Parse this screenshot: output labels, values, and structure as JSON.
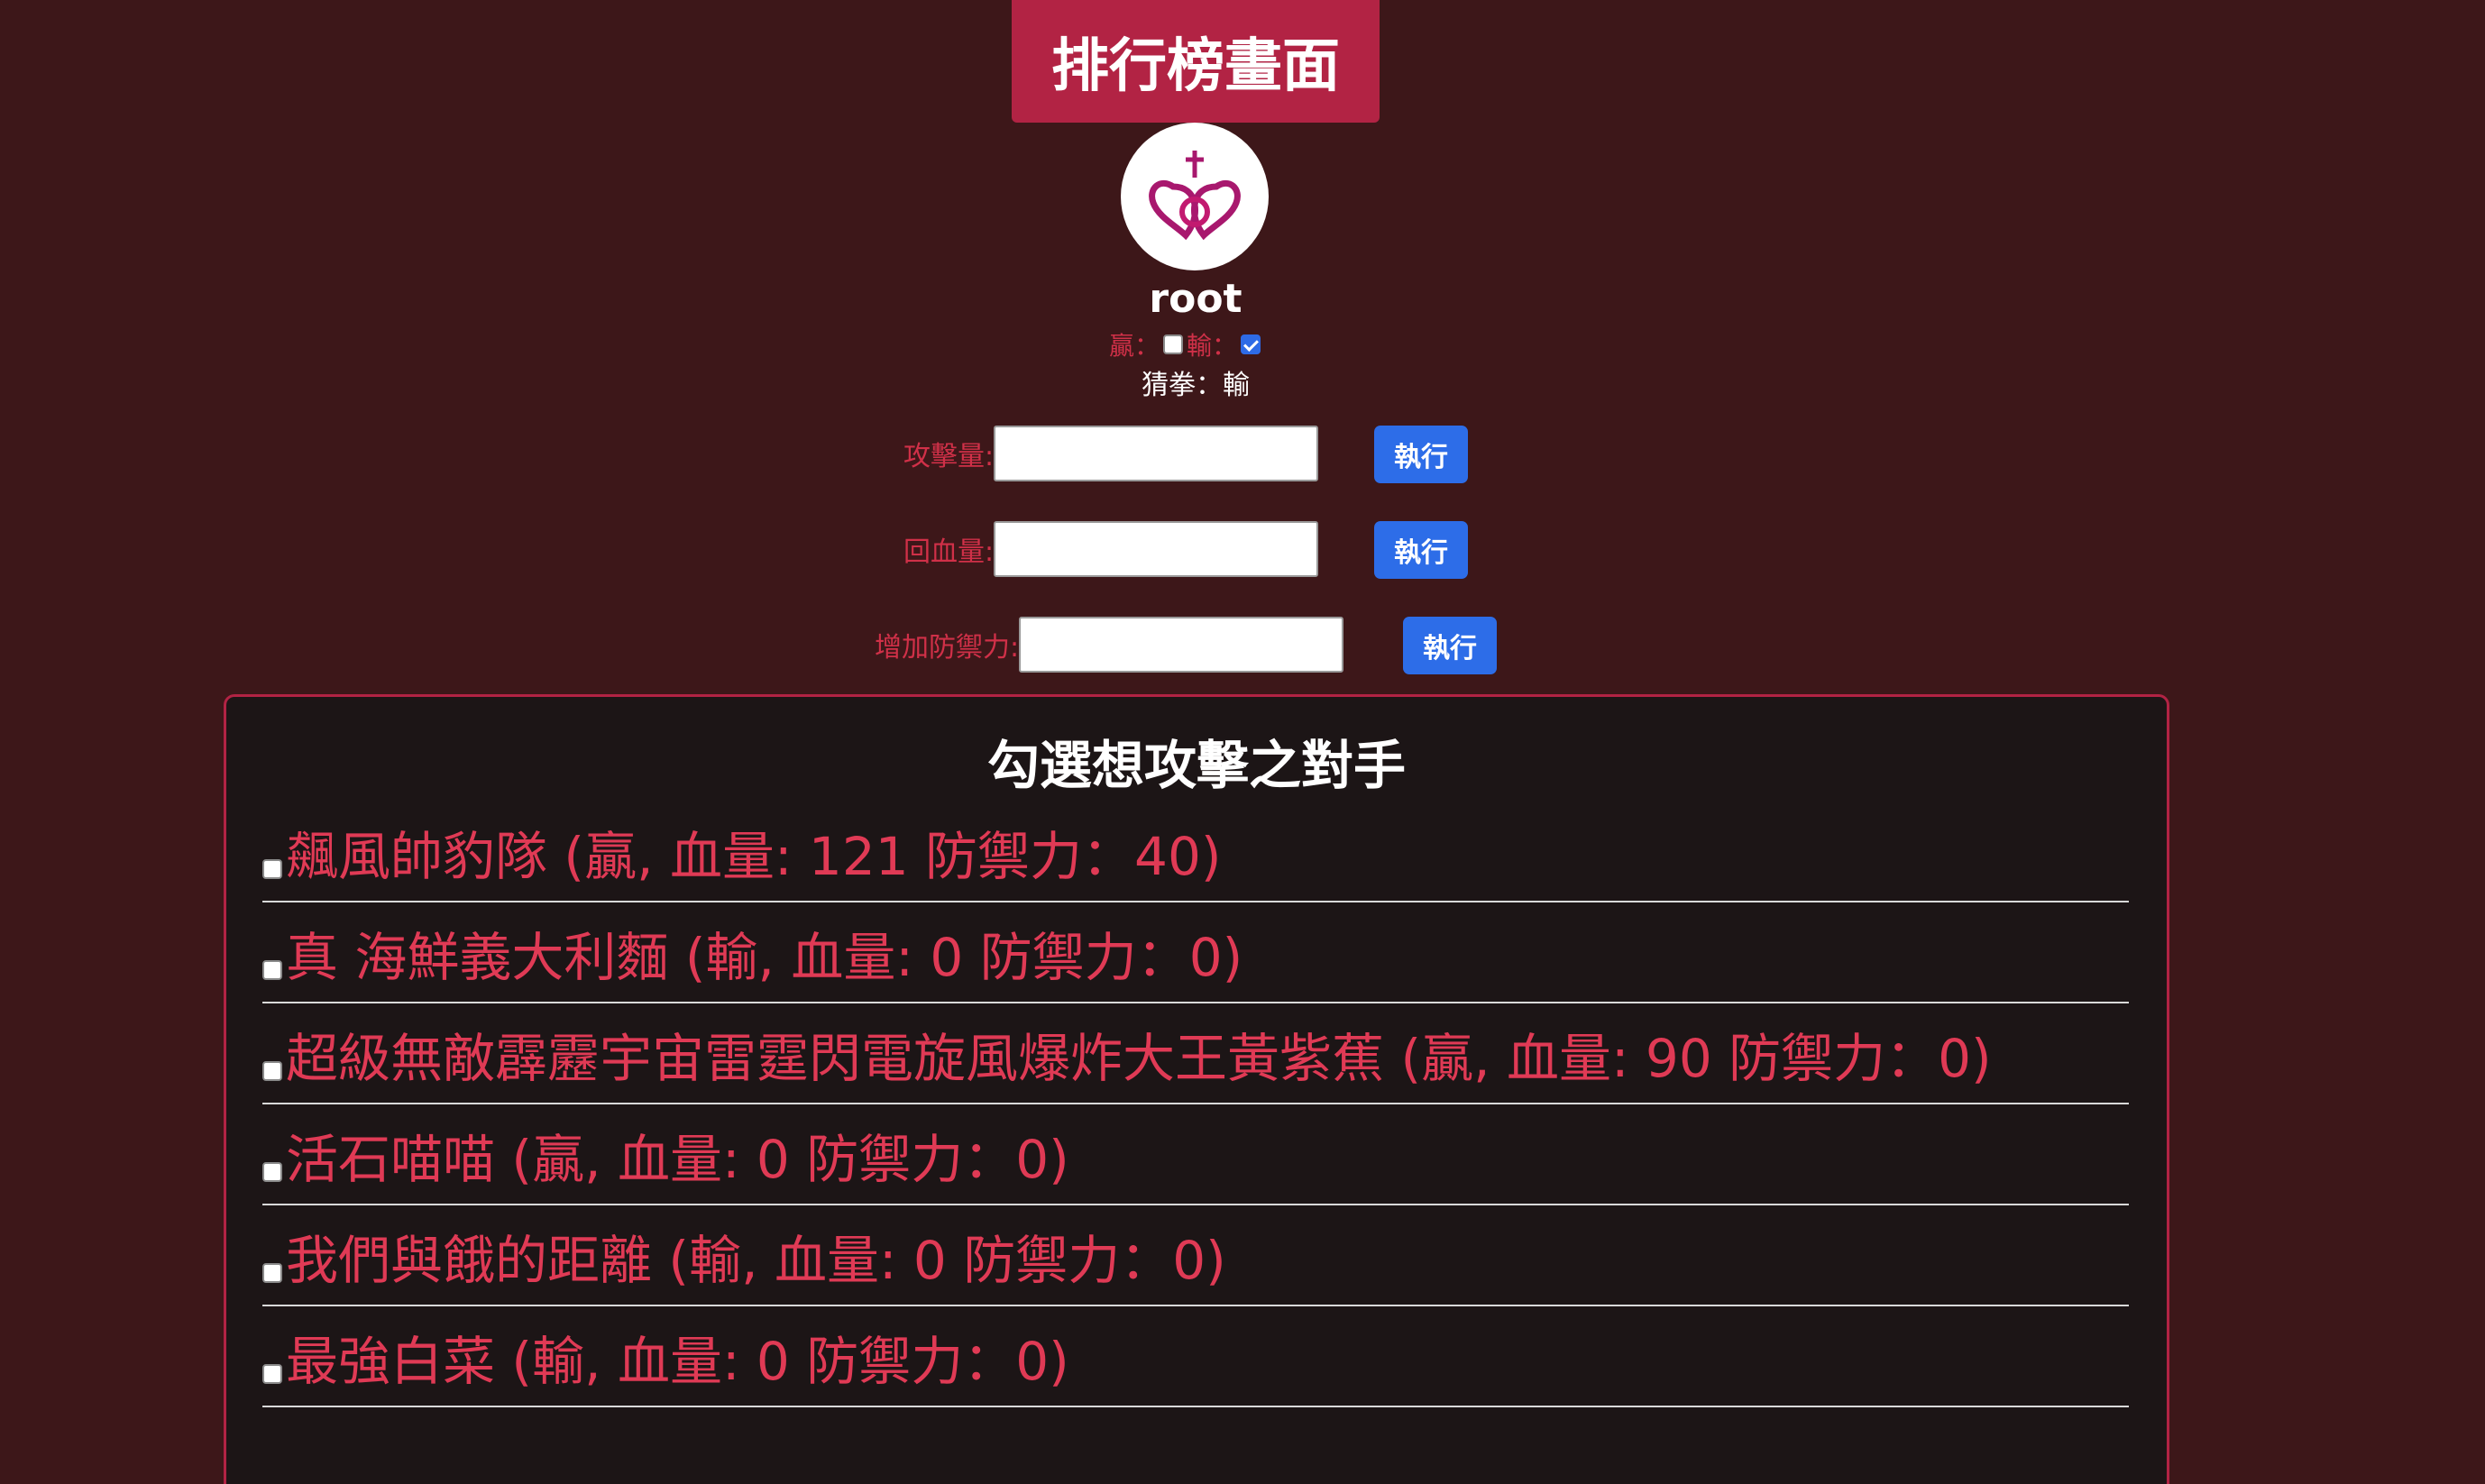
{
  "header": {
    "title_button": "排行榜畫面"
  },
  "profile": {
    "avatar_icon": "crowned-hearts-icon",
    "username": "root",
    "win_label": "贏：",
    "lose_label": "輸：",
    "win_checked": false,
    "lose_checked": true,
    "rps_result": "猜拳：輸"
  },
  "actions": {
    "attack_label": "攻擊量:",
    "heal_label": "回血量:",
    "defense_label": "增加防禦力:",
    "execute_label": "執行",
    "attack_value": "",
    "heal_value": "",
    "defense_value": ""
  },
  "opponents": {
    "title": "勾選想攻擊之對手",
    "items": [
      {
        "label": "飆風帥豹隊 (贏, 血量: 121 防禦力：40)"
      },
      {
        "label": "真 海鮮義大利麵 (輸, 血量: 0 防禦力：0)"
      },
      {
        "label": "超級無敵霹靂宇宙雷霆閃電旋風爆炸大王黃紫蕉 (贏, 血量: 90 防禦力：0)"
      },
      {
        "label": "活石喵喵 (贏, 血量: 0 防禦力：0)"
      },
      {
        "label": "我們與餓的距離 (輸, 血量: 0 防禦力：0)"
      },
      {
        "label": "最強白菜 (輸, 血量: 0 防禦力：0)"
      }
    ]
  },
  "colors": {
    "background": "#3d1719",
    "accent": "#b22344",
    "button_blue": "#2d6de8",
    "opponent_text": "#e03a55"
  }
}
